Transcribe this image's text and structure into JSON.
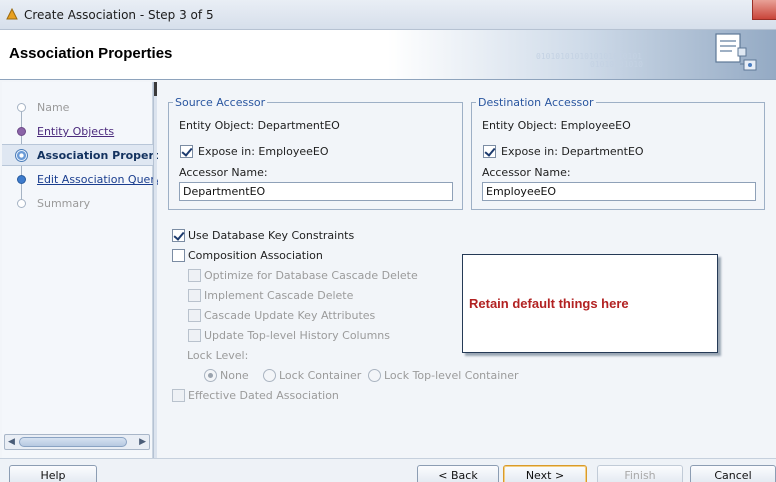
{
  "window": {
    "title": "Create Association - Step 3 of 5"
  },
  "header": {
    "title": "Association Properties",
    "binary_text_1": "0101010101010101010101",
    "binary_text_2": "01010101010"
  },
  "nav": {
    "items": [
      {
        "label": "Name",
        "state": "disabled"
      },
      {
        "label": "Entity Objects",
        "state": "visited"
      },
      {
        "label": "Association Properti",
        "state": "current"
      },
      {
        "label": "Edit Association Query",
        "state": "link"
      },
      {
        "label": "Summary",
        "state": "disabled"
      }
    ]
  },
  "source": {
    "legend": "Source Accessor",
    "entity_label": "Entity Object: DepartmentEO",
    "expose_label": "Expose in: EmployeeEO",
    "expose_checked": true,
    "accessor_label": "Accessor Name:",
    "accessor_value": "DepartmentEO"
  },
  "destination": {
    "legend": "Destination Accessor",
    "entity_label": "Entity Object: EmployeeEO",
    "expose_label": "Expose in: DepartmentEO",
    "expose_checked": true,
    "accessor_label": "Accessor Name:",
    "accessor_value": "EmployeeEO"
  },
  "options": {
    "use_db_key": {
      "label": "Use Database Key Constraints",
      "checked": true
    },
    "composition": {
      "label": "Composition Association",
      "checked": false
    },
    "optimize": {
      "label": "Optimize for Database Cascade Delete"
    },
    "implement": {
      "label": "Implement Cascade Delete"
    },
    "cascade_update": {
      "label": "Cascade Update Key Attributes"
    },
    "update_history": {
      "label": "Update Top-level History Columns"
    },
    "lock_level": {
      "label": "Lock Level:",
      "options": [
        "None",
        "Lock Container",
        "Lock Top-level Container"
      ],
      "selected": "None"
    },
    "effective_dated": {
      "label": "Effective Dated Association"
    }
  },
  "note": {
    "text": "Retain default things here",
    "color": "#b22222"
  },
  "buttons": {
    "help": "Help",
    "back": "< Back",
    "next": "Next >",
    "finish": "Finish",
    "cancel": "Cancel"
  }
}
